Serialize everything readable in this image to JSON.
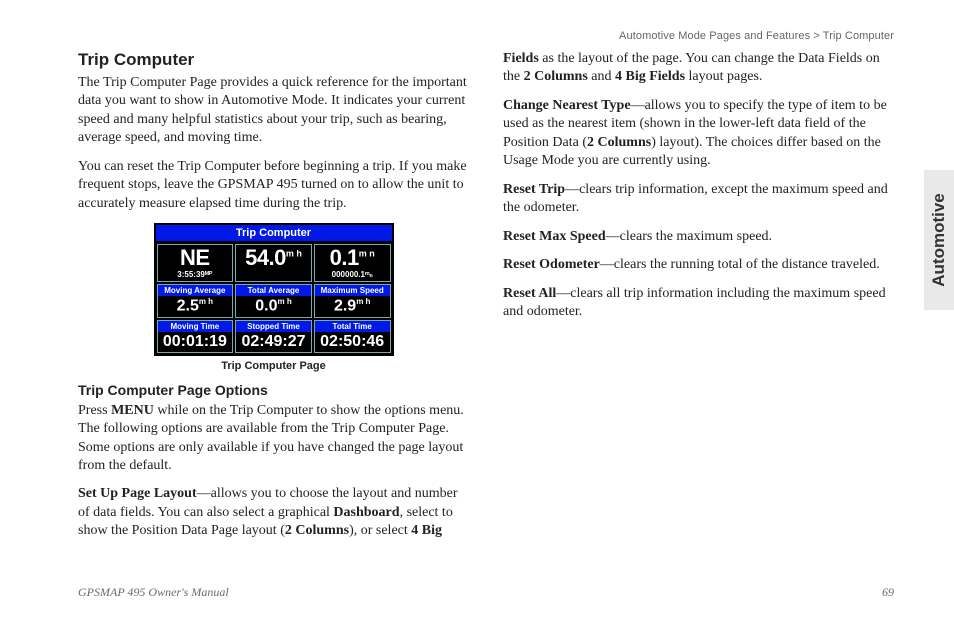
{
  "breadcrumb": "Automotive Mode Pages and Features > Trip Computer",
  "sidetab": "Automotive",
  "h1": "Trip Computer",
  "p1": "The Trip Computer Page provides a quick reference for the important data you want to show in Automotive Mode. It indicates your current speed and many helpful statistics about your trip, such as bearing, average speed, and moving time.",
  "p2": "You can reset the Trip Computer before beginning a trip. If you make frequent stops, leave the GPSMAP 495 turned on to allow the unit to accurately measure elapsed time during the trip.",
  "fig": {
    "title": "Trip Computer",
    "caption": "Trip Computer Page",
    "row1": {
      "c1_big": "NE",
      "c1_sub": "3:55:39ᴹᴾ",
      "c2_big": "54.0",
      "c2_unit": "m h",
      "c3_big": "0.1",
      "c3_unit": "m n",
      "c3_sub": "000000.1ᵐₙ"
    },
    "row2": {
      "l1": "Moving Average",
      "v1": "2.5",
      "u1": "m h",
      "l2": "Total Average",
      "v2": "0.0",
      "u2": "m h",
      "l3": "Maximum Speed",
      "v3": "2.9",
      "u3": "m h"
    },
    "row3": {
      "l1": "Moving Time",
      "v1": "00:01:19",
      "l2": "Stopped Time",
      "v2": "02:49:27",
      "l3": "Total Time",
      "v3": "02:50:46"
    }
  },
  "h2": "Trip Computer Page Options",
  "p3a": "Press ",
  "p3b": "MENU",
  "p3c": " while on the Trip Computer to show the options menu. The following options are available from the Trip Computer Page. Some options are only available if you have changed the page layout from the default.",
  "opt1": {
    "b": "Set Up Page Layout",
    "t1": "—allows you to choose the layout and number of data fields. You can also select a graphical ",
    "b2": "Dashboard",
    "t2": ", select to show the Position Data Page layout (",
    "b3": "2 Columns",
    "t3": "), or select ",
    "b4": "4 Big Fields",
    "t4": " as the layout of the page. You can change the Data Fields on the ",
    "b5": "2 Columns",
    "t5": " and ",
    "b6": "4 Big Fields",
    "t6": " layout pages."
  },
  "opt2": {
    "b": "Change Nearest Type",
    "t1": "—allows you to specify the type of item to be used as the nearest item (shown in the lower-left data field of the Position Data (",
    "b2": "2 Columns",
    "t2": ") layout). The choices differ based on the Usage Mode you are currently using."
  },
  "opt3": {
    "b": "Reset Trip",
    "t": "—clears trip information, except the maximum speed and the odometer."
  },
  "opt4": {
    "b": "Reset Max Speed",
    "t": "—clears the maximum speed."
  },
  "opt5": {
    "b": "Reset Odometer",
    "t": "—clears the running total of the distance traveled."
  },
  "opt6": {
    "b": "Reset All",
    "t": "—clears all trip information including the maximum speed and odometer."
  },
  "footer_left": "GPSMAP 495 Owner's Manual",
  "footer_right": "69"
}
